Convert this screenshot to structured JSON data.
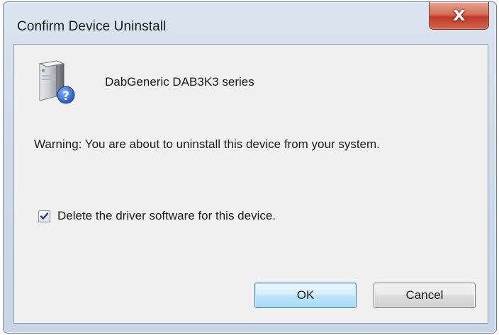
{
  "window": {
    "title": "Confirm Device Uninstall",
    "close_glyph": "X"
  },
  "device": {
    "icon": "device-question-icon",
    "name": "DabGeneric DAB3K3 series"
  },
  "message": {
    "warning": "Warning: You are about to uninstall this device from your system."
  },
  "delete_driver": {
    "label": "Delete the driver software for this device.",
    "checked": true
  },
  "buttons": {
    "ok_label": "OK",
    "cancel_label": "Cancel"
  },
  "colors": {
    "close_button": "#c0392b",
    "default_button_border": "#3c7fb1",
    "help_badge": "#2b62c9"
  }
}
